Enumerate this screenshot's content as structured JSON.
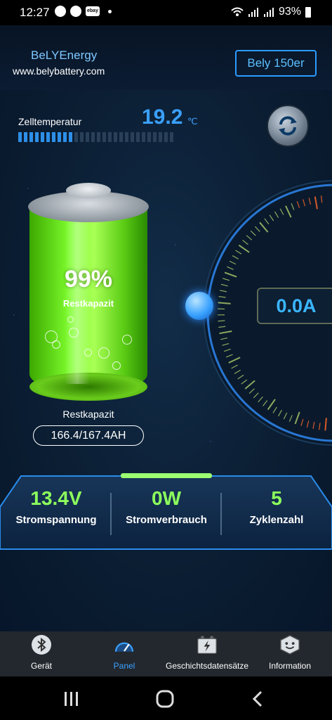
{
  "status_bar": {
    "time": "12:27",
    "left_icons": [
      "notification-icon",
      "download-icon",
      "ebay-icon",
      "dot-icon"
    ],
    "ebay_label": "ebay",
    "battery_percent": "93%"
  },
  "header": {
    "brand": "BeLYEnergy",
    "website": "www.belybattery.com",
    "device_button": "Bely 150er"
  },
  "temperature": {
    "label": "Zelltemperatur",
    "value": "19.2",
    "unit": "℃",
    "bar_fraction": 0.36
  },
  "battery": {
    "percent": "99%",
    "sub_label": "Restkapazit",
    "capacity_label": "Restkapazit",
    "capacity_value": "166.4/167.4AH",
    "fill_color": "#7fff2e"
  },
  "gauge": {
    "current": "0.0A",
    "accent": "#3ab6ff"
  },
  "stats": [
    {
      "value": "13.4V",
      "label": "Stromspannung"
    },
    {
      "value": "0W",
      "label": "Stromverbrauch"
    },
    {
      "value": "5",
      "label": "Zyklenzahl"
    }
  ],
  "tabs": [
    {
      "label": "Gerät",
      "icon": "bluetooth-icon"
    },
    {
      "label": "Panel",
      "icon": "speedometer-icon",
      "active": true
    },
    {
      "label": "Geschichtsdatensätze",
      "icon": "battery-history-icon"
    },
    {
      "label": "Information",
      "icon": "smiley-icon"
    }
  ],
  "colors": {
    "accent_blue": "#3aa0ff",
    "stat_green": "#8cff5c",
    "panel_border": "#2b9cff"
  }
}
